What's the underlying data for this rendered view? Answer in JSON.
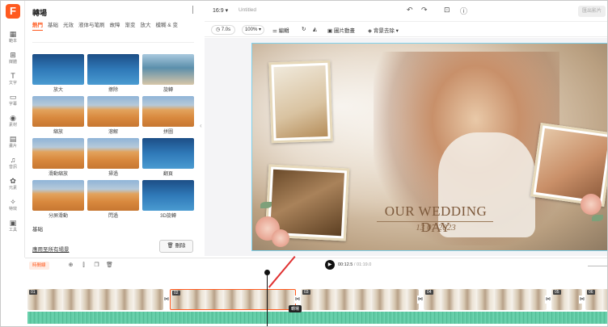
{
  "app": {
    "logo_letter": "F"
  },
  "rail": [
    {
      "icon": "▦",
      "label": "範本",
      "name": "rail-templates"
    },
    {
      "icon": "⊞",
      "label": "媒體",
      "name": "rail-media"
    },
    {
      "icon": "T",
      "label": "文字",
      "name": "rail-text"
    },
    {
      "icon": "▭",
      "label": "字幕",
      "name": "rail-subtitles"
    },
    {
      "icon": "◉",
      "label": "素材",
      "name": "rail-elements"
    },
    {
      "icon": "▤",
      "label": "畫片",
      "name": "rail-overlays"
    },
    {
      "icon": "♫",
      "label": "音訊",
      "name": "rail-audio"
    },
    {
      "icon": "✿",
      "label": "元素",
      "name": "rail-stickers"
    },
    {
      "icon": "✧",
      "label": "特效",
      "name": "rail-effects"
    },
    {
      "icon": "▣",
      "label": "工具",
      "name": "rail-tools"
    }
  ],
  "panel": {
    "title": "轉場",
    "tabs": [
      "熱門",
      "基础",
      "光效",
      "液体与笔刷",
      "故障",
      "渐变",
      "放大",
      "模糊 & 变"
    ],
    "active_tab": 0,
    "tiles": [
      {
        "label": "放大",
        "theme": "ocean"
      },
      {
        "label": "擦除",
        "theme": "ocean"
      },
      {
        "label": "旋轉",
        "theme": "beach"
      },
      {
        "label": "縮放",
        "theme": "desert"
      },
      {
        "label": "溶解",
        "theme": "desert"
      },
      {
        "label": "拼圖",
        "theme": "desert"
      },
      {
        "label": "滑動縮放",
        "theme": "desert"
      },
      {
        "label": "掃過",
        "theme": "desert"
      },
      {
        "label": "翻頁",
        "theme": "ocean"
      },
      {
        "label": "分屏滑動",
        "theme": "desert"
      },
      {
        "label": "閃過",
        "theme": "desert"
      },
      {
        "label": "3D旋轉",
        "theme": "ocean"
      }
    ],
    "section_basic": "基础",
    "apply_all": "應用至所有場景",
    "delete_label": "刪除"
  },
  "topbar": {
    "ratio": "16:9",
    "title_placeholder": "Untitled",
    "export_label": "匯出影片"
  },
  "toolbar": {
    "duration": "7.0s",
    "zoom": "100%",
    "edit_label": "編輯",
    "animation_label": "圖片動畫",
    "bg_remove_label": "背景去除"
  },
  "canvas": {
    "title": "OUR WEDDING DAY",
    "date": "13 07 2023"
  },
  "timeline": {
    "tag_label": "時間線",
    "time_current": "00:12.5",
    "time_total": "/ 01:19.0",
    "tooltip": "轉場",
    "clips": [
      "01",
      "02",
      "03",
      "04",
      "05",
      "06"
    ]
  }
}
